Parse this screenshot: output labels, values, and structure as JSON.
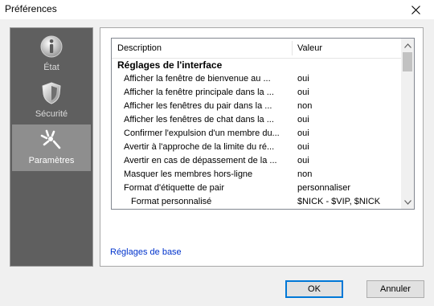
{
  "window": {
    "title": "Préférences"
  },
  "sidebar": {
    "items": [
      {
        "label": "État",
        "icon": "info-icon"
      },
      {
        "label": "Sécurité",
        "icon": "shield-icon"
      },
      {
        "label": "Paramètres",
        "icon": "sparkle-icon",
        "active": true
      }
    ]
  },
  "grid": {
    "columns": [
      "Description",
      "Valeur"
    ],
    "rows": [
      {
        "label": "Réglages de l'interface",
        "value": "",
        "type": "section"
      },
      {
        "label": "Afficher la fenêtre de bienvenue au ...",
        "value": "oui"
      },
      {
        "label": "Afficher la fenêtre principale dans la ...",
        "value": "oui"
      },
      {
        "label": "Afficher les fenêtres du pair dans la ...",
        "value": "non"
      },
      {
        "label": "Afficher les fenêtres de chat dans la ...",
        "value": "oui"
      },
      {
        "label": "Confirmer l'expulsion d'un membre du...",
        "value": "oui"
      },
      {
        "label": "Avertir à l'approche de la limite du ré...",
        "value": "oui"
      },
      {
        "label": "Avertir en cas de dépassement de la ...",
        "value": "oui"
      },
      {
        "label": "Masquer les membres hors-ligne",
        "value": "non"
      },
      {
        "label": "Format d'étiquette de pair",
        "value": "personnaliser"
      },
      {
        "label": "Format personnalisé",
        "value": "$NICK - $VIP, $NICK",
        "type": "child"
      }
    ]
  },
  "link": {
    "label": "Réglages de base"
  },
  "buttons": {
    "ok": "OK",
    "cancel": "Annuler"
  }
}
